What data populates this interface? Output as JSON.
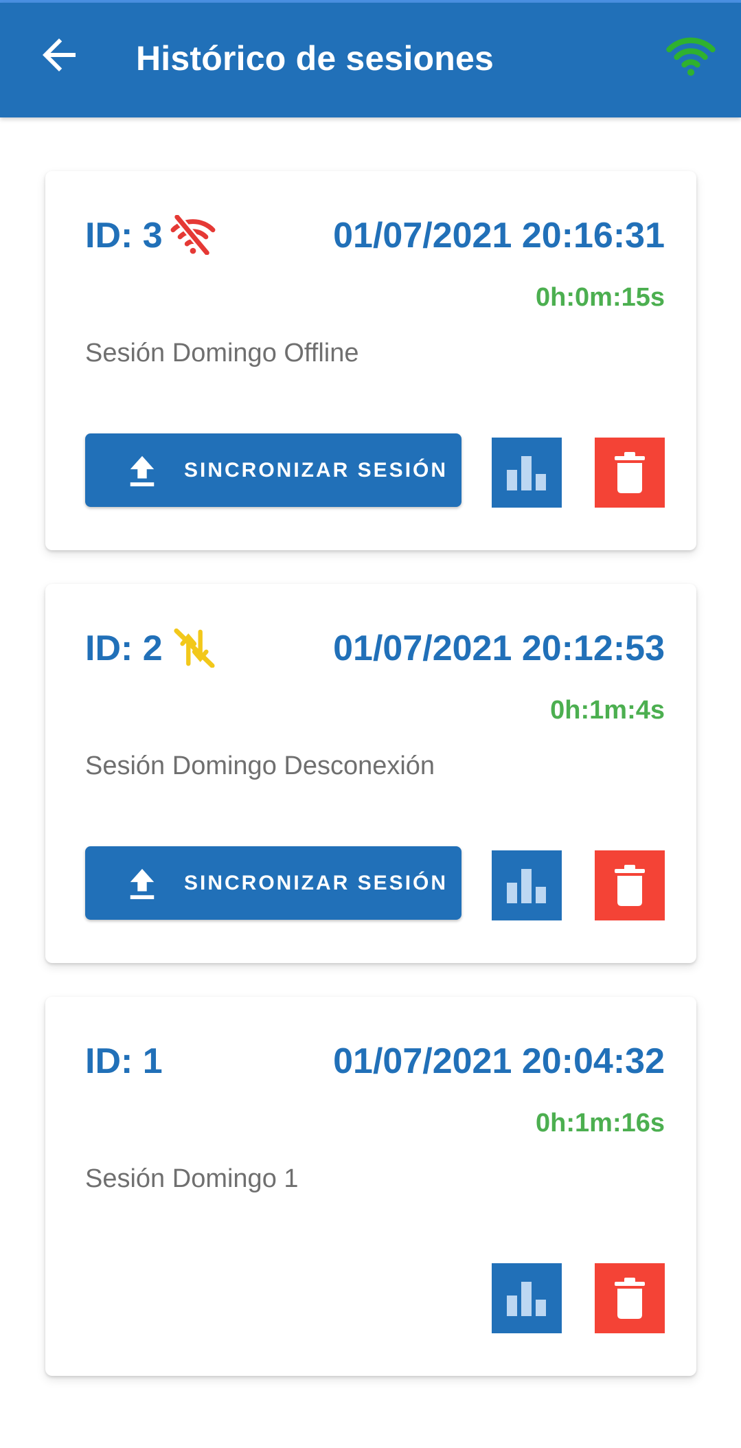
{
  "appbar": {
    "title": "Histórico de sesiones",
    "back_icon": "arrow-back-icon",
    "connection_icon": "wifi-icon",
    "connection_color": "#2fb12f"
  },
  "colors": {
    "primary": "#2170b8",
    "duration": "#4caf50",
    "delete": "#f44336",
    "offline": "#e53935",
    "disconnected": "#f2c81b"
  },
  "sessions": [
    {
      "id_label": "ID: 3",
      "status_icon": "wifi-off-icon",
      "date": "01/07/2021 20:16:31",
      "duration": "0h:0m:15s",
      "name": "Sesión Domingo Offline",
      "sync_label": "SINCRONIZAR SESIÓN"
    },
    {
      "id_label": "ID: 2",
      "status_icon": "sync-disabled-icon",
      "date": "01/07/2021 20:12:53",
      "duration": "0h:1m:4s",
      "name": "Sesión Domingo Desconexión",
      "sync_label": "SINCRONIZAR SESIÓN"
    },
    {
      "id_label": "ID: 1",
      "date": "01/07/2021 20:04:32",
      "duration": "0h:1m:16s",
      "name": "Sesión Domingo 1"
    }
  ]
}
